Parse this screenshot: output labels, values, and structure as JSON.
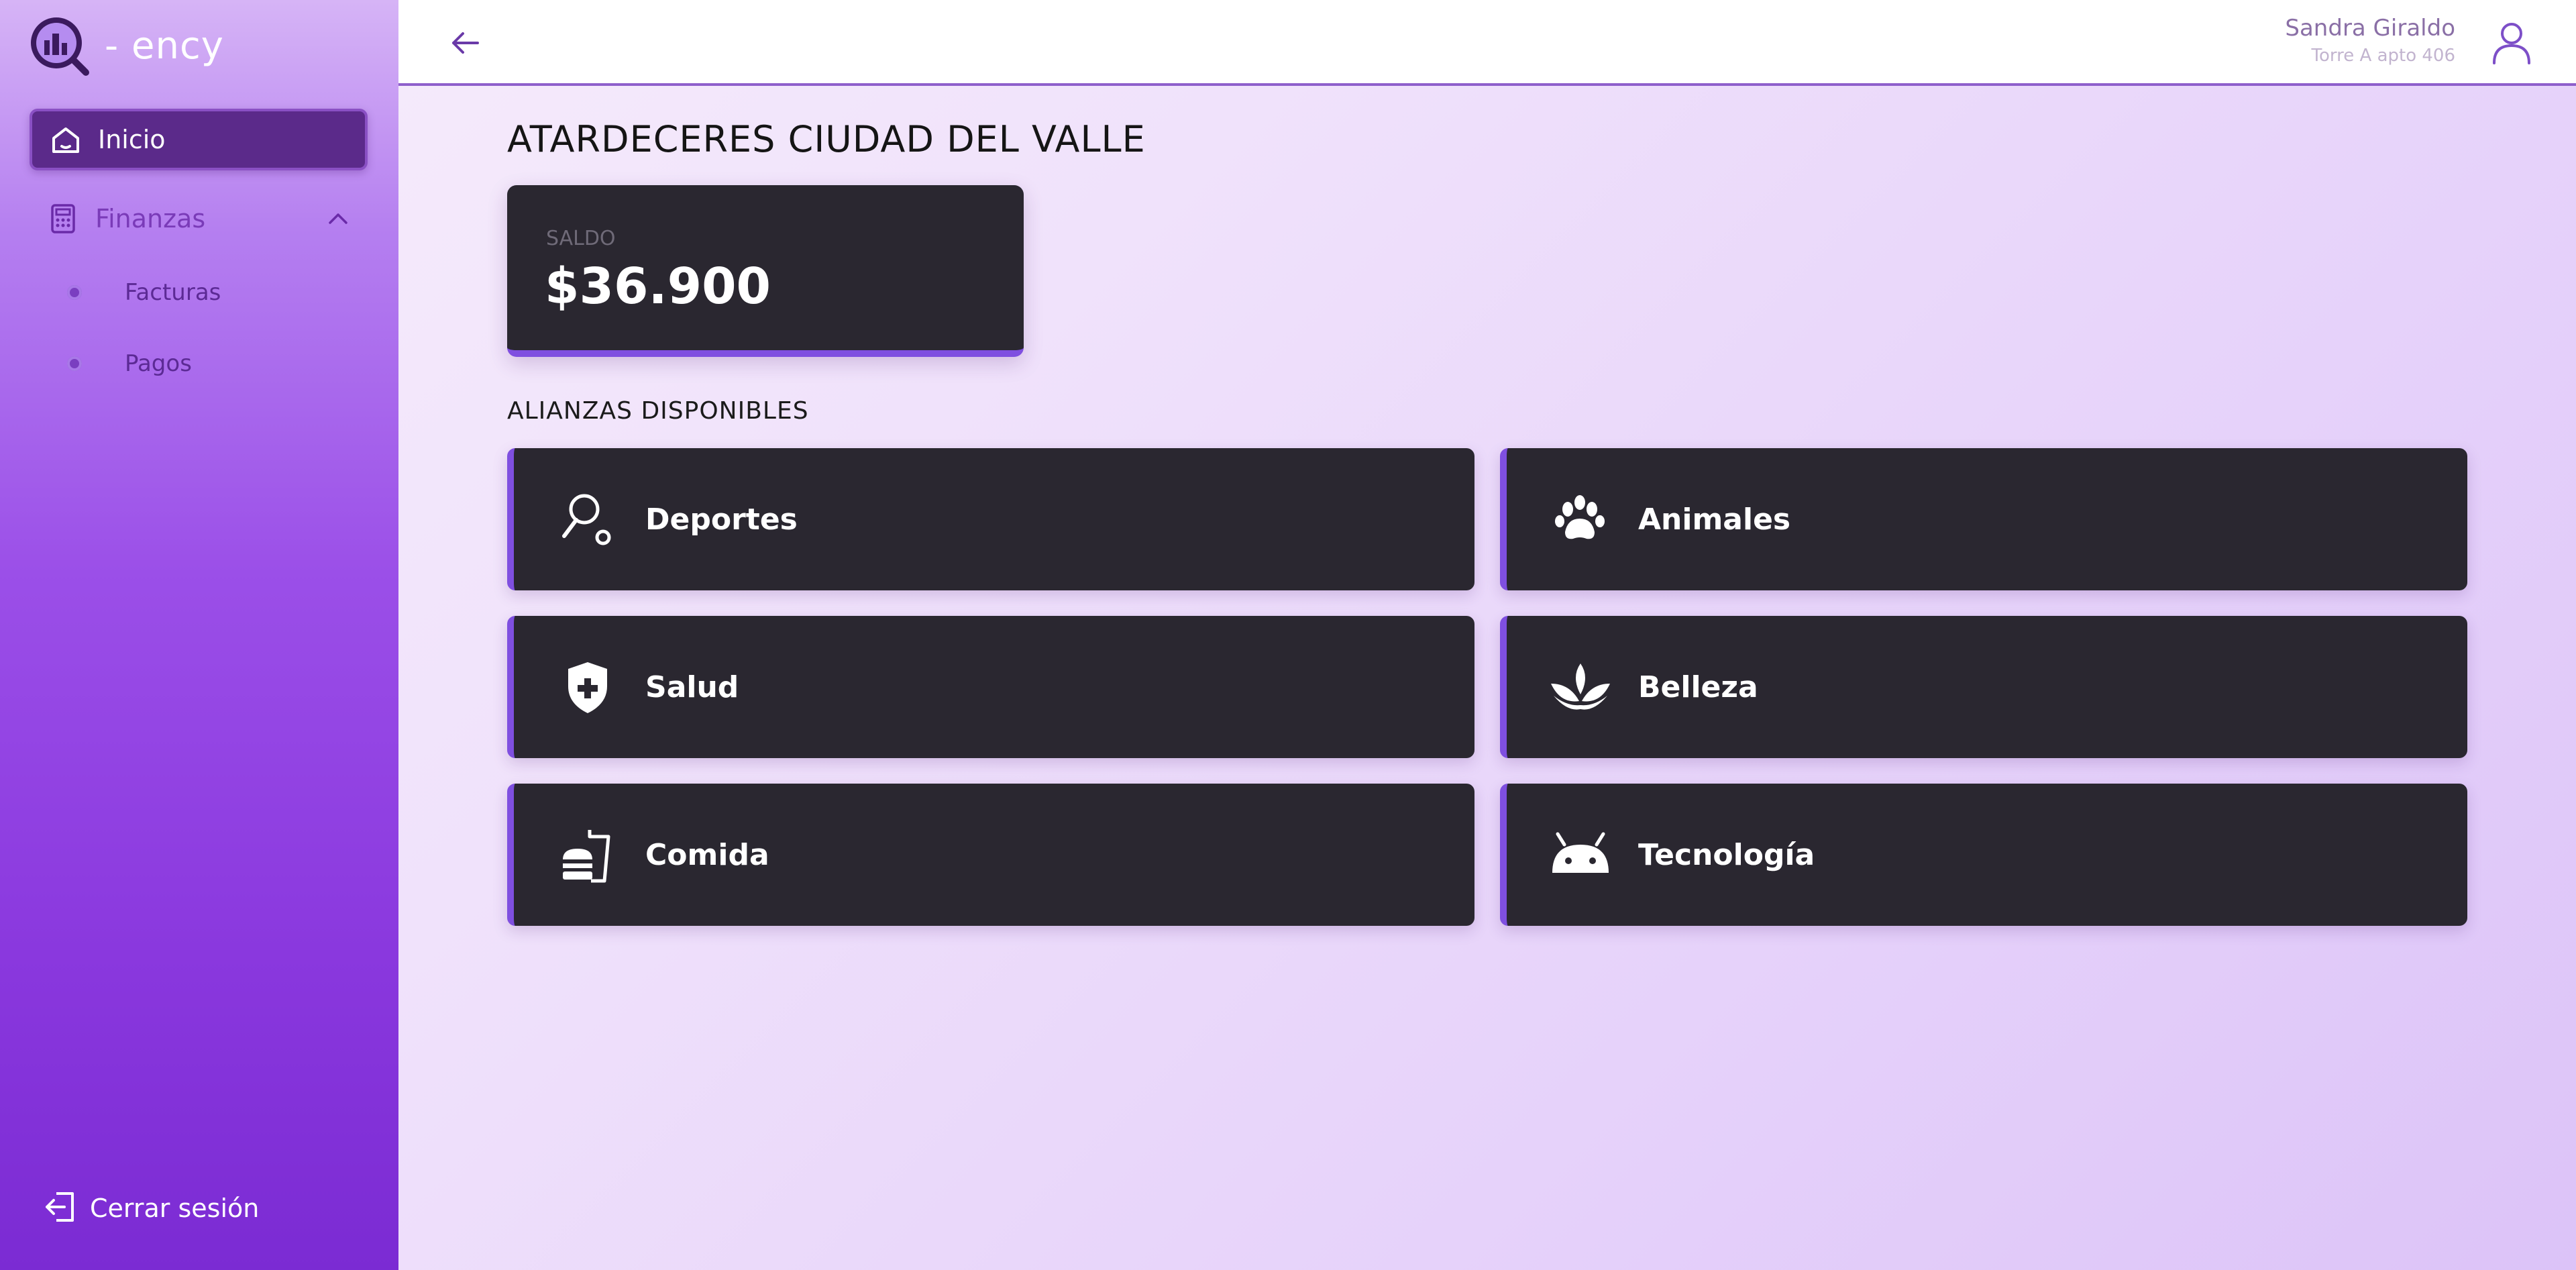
{
  "brand": {
    "name": "- ency"
  },
  "sidebar": {
    "items": [
      {
        "label": "Inicio",
        "icon": "home-icon",
        "active": true
      },
      {
        "label": "Finanzas",
        "icon": "calculator-icon",
        "expanded": true,
        "children": [
          {
            "label": "Facturas"
          },
          {
            "label": "Pagos"
          }
        ]
      }
    ],
    "logout_label": "Cerrar sesión"
  },
  "header": {
    "back_icon": "arrow-left-icon",
    "user_name": "Sandra Giraldo",
    "user_unit": "Torre A apto 406",
    "avatar_icon": "user-icon"
  },
  "main": {
    "title": "ATARDECERES CIUDAD DEL VALLE",
    "balance": {
      "label": "SALDO",
      "value": "$36.900"
    },
    "section_label": "ALIANZAS DISPONIBLES",
    "alliances": [
      {
        "label": "Deportes",
        "icon": "racket-icon"
      },
      {
        "label": "Animales",
        "icon": "paw-icon"
      },
      {
        "label": "Salud",
        "icon": "shield-plus-icon"
      },
      {
        "label": "Belleza",
        "icon": "lotus-icon"
      },
      {
        "label": "Comida",
        "icon": "fastfood-icon"
      },
      {
        "label": "Tecnología",
        "icon": "android-icon"
      }
    ]
  },
  "colors": {
    "accent": "#7f4fe0",
    "card_bg": "#2a2730",
    "sidebar_active": "#5b2a8a"
  }
}
